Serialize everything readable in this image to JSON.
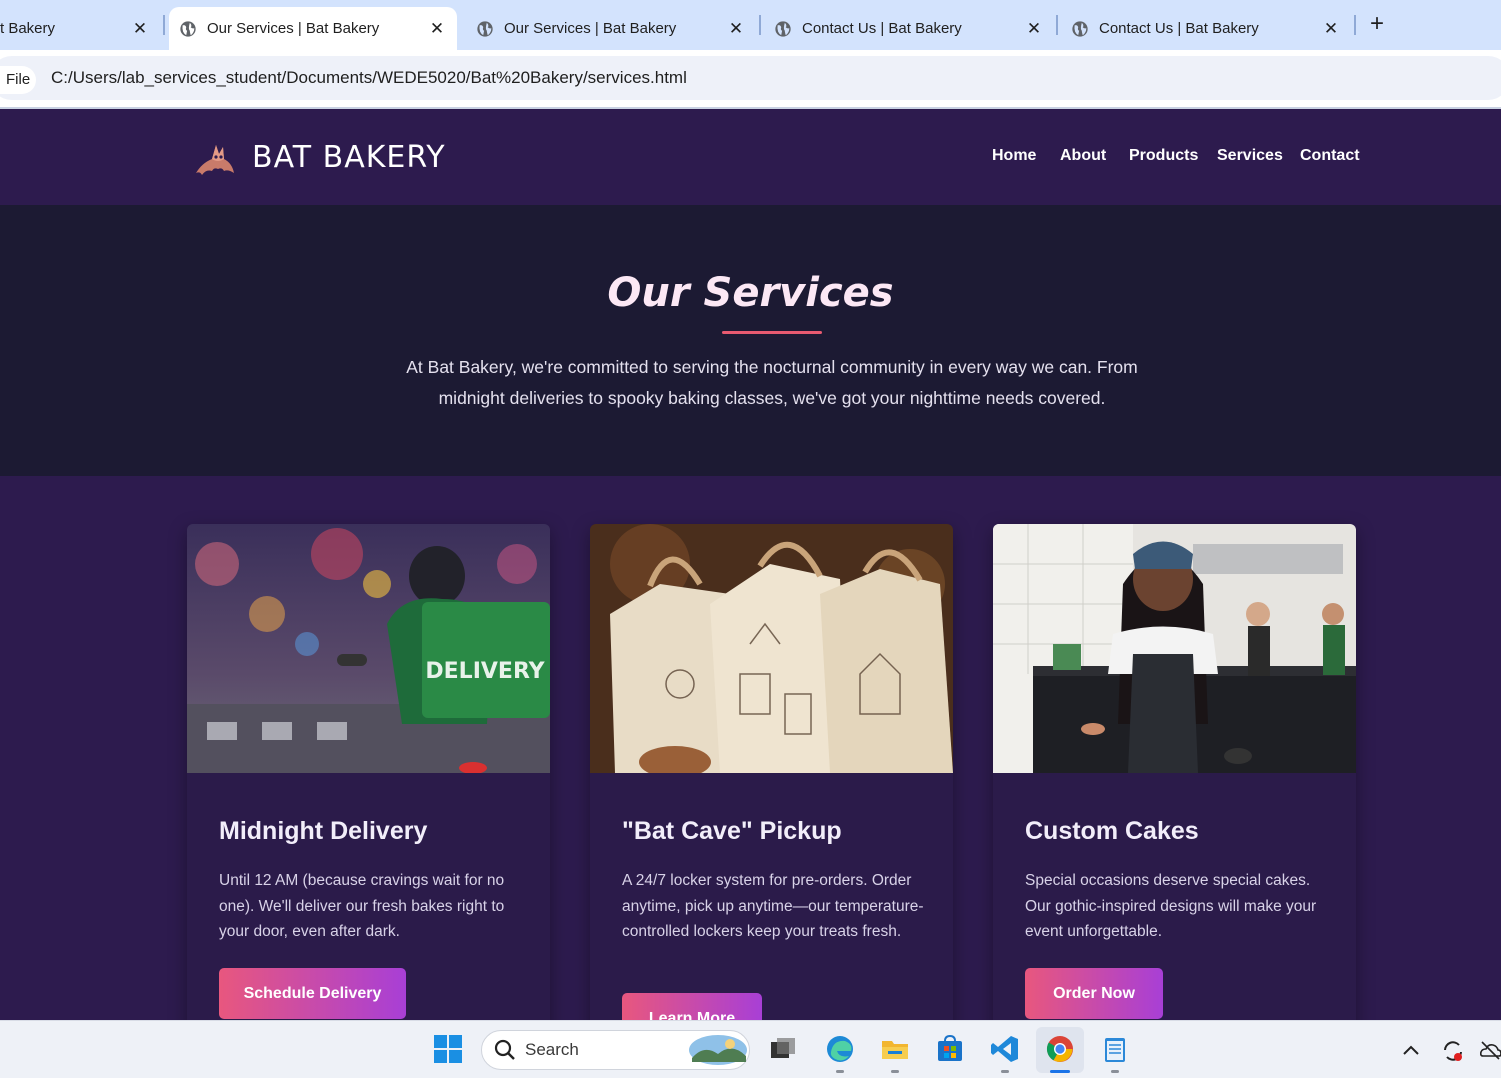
{
  "browser": {
    "tabs": [
      {
        "title": "t Bakery",
        "active": false
      },
      {
        "title": "Our Services | Bat Bakery",
        "active": true
      },
      {
        "title": "Our Services | Bat Bakery",
        "active": false
      },
      {
        "title": "Contact Us | Bat Bakery",
        "active": false
      },
      {
        "title": "Contact Us | Bat Bakery",
        "active": false
      }
    ],
    "close_glyph": "✕",
    "new_tab_glyph": "+",
    "scheme_chip": "File",
    "url": "C:/Users/lab_services_student/Documents/WEDE5020/Bat%20Bakery/services.html"
  },
  "site": {
    "brand": "BAT BAKERY",
    "nav": [
      "Home",
      "About",
      "Products",
      "Services",
      "Contact"
    ],
    "colors": {
      "header": "#2d1b4e",
      "hero": "#1c1a33",
      "accent": "#e85a70",
      "button_start": "#e8577e",
      "button_end": "#a83fd6"
    }
  },
  "hero": {
    "title": "Our Services",
    "text": "At Bat Bakery, we're committed to serving the nocturnal community in every way we can. From midnight deliveries to spooky baking classes, we've got your nighttime needs covered."
  },
  "services": [
    {
      "name": "Midnight Delivery",
      "description": "Until 12 AM (because cravings wait for no one). We'll deliver our fresh bakes right to your door, even after dark.",
      "button": "Schedule Delivery",
      "image_text": "DELIVERY"
    },
    {
      "name": "\"Bat Cave\" Pickup",
      "description": "A 24/7 locker system for pre-orders. Order anytime, pick up anytime—our temperature-controlled lockers keep your treats fresh.",
      "button": "Learn More"
    },
    {
      "name": "Custom Cakes",
      "description": "Special occasions deserve special cakes. Our gothic-inspired designs will make your event unforgettable.",
      "button": "Order Now"
    }
  ],
  "taskbar": {
    "search_placeholder": "Search",
    "icons": [
      "windows-start-icon",
      "search-icon",
      "task-view-icon",
      "edge-icon",
      "file-explorer-icon",
      "microsoft-store-icon",
      "vscode-icon",
      "chrome-icon",
      "notepad-icon"
    ],
    "tray_icons": [
      "chevron-up-icon",
      "sync-icon",
      "onedrive-icon"
    ]
  }
}
